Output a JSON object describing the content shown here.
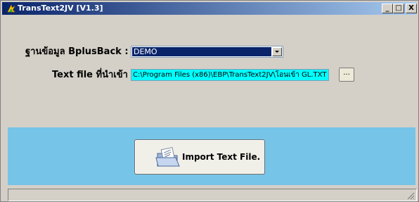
{
  "window": {
    "title": "TransText2JV [V1.3]",
    "controls": {
      "minimize": "_",
      "maximize": "□",
      "close": "X"
    }
  },
  "form": {
    "database_label": "ฐานข้อมูล BplusBack :",
    "database_value": "DEMO",
    "textfile_label": "Text file ที่นำเข้า :",
    "textfile_value": "C:\\Program Files (x86)\\EBP\\TransText2JV\\โอนเข้า GL.TXT",
    "browse_label": "..."
  },
  "actions": {
    "import_label": "Import Text File."
  },
  "icons": {
    "app": "trans-app-icon",
    "import": "open-folder-icon",
    "dropdown": "chevron-down-icon",
    "resize": "resize-grip-icon"
  },
  "colors": {
    "titlebar_start": "#0a246a",
    "titlebar_end": "#a6caf0",
    "band": "#76c4e8",
    "path_field": "#00ffff",
    "selection": "#0a246a"
  }
}
